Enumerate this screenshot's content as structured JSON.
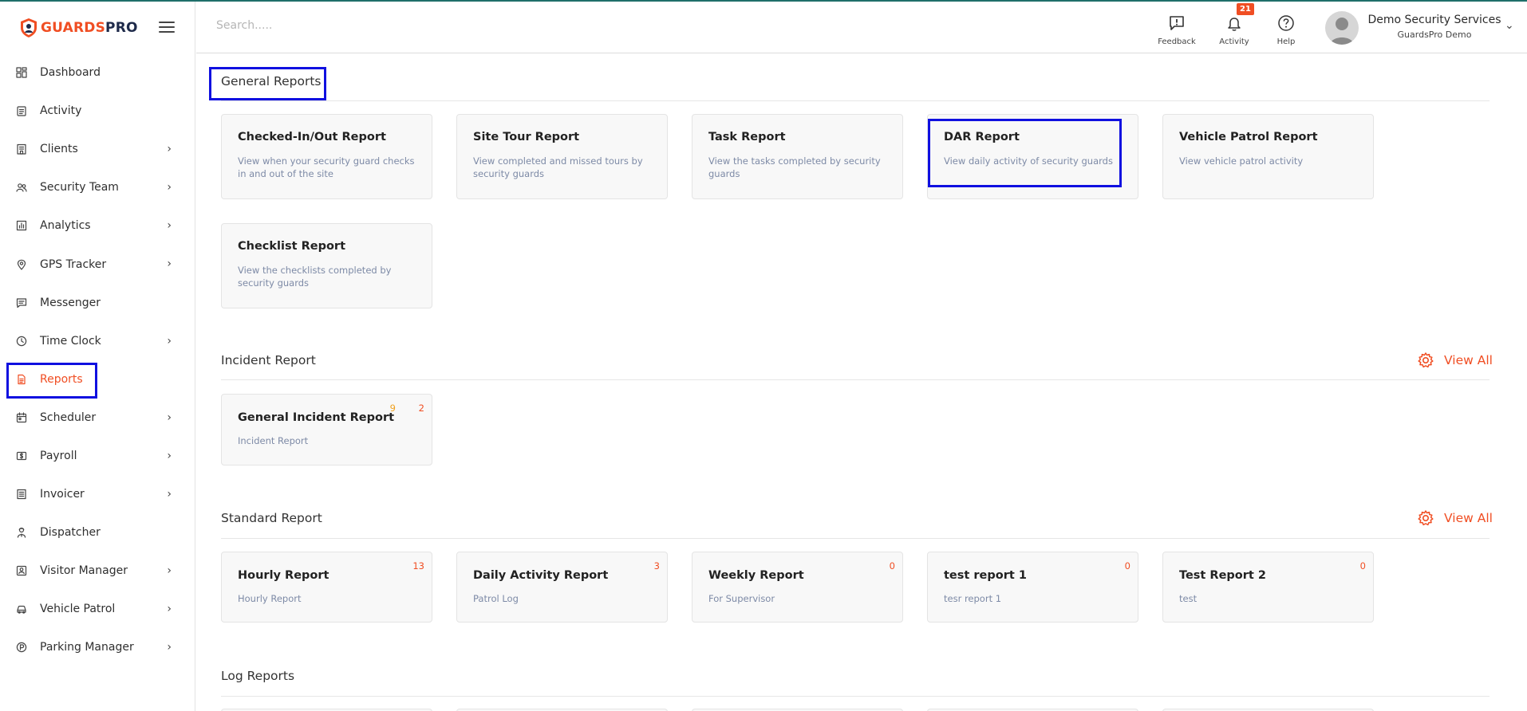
{
  "app": {
    "brand_part1": "GUARDS",
    "brand_part2": "PRO"
  },
  "sidebar": {
    "items": [
      {
        "label": "Dashboard",
        "icon": "dashboard-icon",
        "chevron": false
      },
      {
        "label": "Activity",
        "icon": "clipboard-icon",
        "chevron": false
      },
      {
        "label": "Clients",
        "icon": "building-icon",
        "chevron": true
      },
      {
        "label": "Security Team",
        "icon": "users-icon",
        "chevron": true
      },
      {
        "label": "Analytics",
        "icon": "bar-chart-icon",
        "chevron": true
      },
      {
        "label": "GPS Tracker",
        "icon": "map-pin-icon",
        "chevron": true
      },
      {
        "label": "Messenger",
        "icon": "message-icon",
        "chevron": false
      },
      {
        "label": "Time Clock",
        "icon": "clock-icon",
        "chevron": true
      },
      {
        "label": "Reports",
        "icon": "document-icon",
        "chevron": false,
        "active": true
      },
      {
        "label": "Scheduler",
        "icon": "calendar-icon",
        "chevron": true
      },
      {
        "label": "Payroll",
        "icon": "dollar-icon",
        "chevron": true
      },
      {
        "label": "Invoicer",
        "icon": "invoice-icon",
        "chevron": true
      },
      {
        "label": "Dispatcher",
        "icon": "dispatcher-icon",
        "chevron": false
      },
      {
        "label": "Visitor Manager",
        "icon": "id-card-icon",
        "chevron": true
      },
      {
        "label": "Vehicle Patrol",
        "icon": "car-icon",
        "chevron": true
      },
      {
        "label": "Parking Manager",
        "icon": "parking-icon",
        "chevron": true
      }
    ]
  },
  "header": {
    "search_placeholder": "Search.....",
    "feedback_label": "Feedback",
    "activity_label": "Activity",
    "activity_badge": "21",
    "help_label": "Help",
    "user_name": "Demo Security Services",
    "user_company": "GuardsPro Demo"
  },
  "general_reports": {
    "title": "General Reports",
    "cards": [
      {
        "title": "Checked-In/Out Report",
        "desc": "View when your security guard checks in and out of the site"
      },
      {
        "title": "Site Tour Report",
        "desc": "View completed and missed tours by security guards"
      },
      {
        "title": "Task Report",
        "desc": "View the tasks completed by security guards"
      },
      {
        "title": "DAR Report",
        "desc": "View daily activity of security guards"
      },
      {
        "title": "Vehicle Patrol Report",
        "desc": "View vehicle patrol activity"
      },
      {
        "title": "Checklist Report",
        "desc": "View the checklists completed by security guards"
      }
    ]
  },
  "incident_report": {
    "title": "Incident Report",
    "view_all": "View All",
    "cards": [
      {
        "title": "General Incident Report",
        "desc": "Incident Report",
        "count_orange": "9",
        "count_red": "2"
      }
    ]
  },
  "standard_report": {
    "title": "Standard Report",
    "view_all": "View All",
    "cards": [
      {
        "title": "Hourly Report",
        "desc": "Hourly Report",
        "count": "13"
      },
      {
        "title": "Daily Activity Report",
        "desc": "Patrol Log",
        "count": "3"
      },
      {
        "title": "Weekly Report",
        "desc": "For Supervisor",
        "count": "0"
      },
      {
        "title": "test report 1",
        "desc": "tesr report 1",
        "count": "0"
      },
      {
        "title": "Test Report 2",
        "desc": "test",
        "count": "0"
      }
    ]
  },
  "log_reports": {
    "title": "Log Reports"
  },
  "colors": {
    "accent": "#f04e23",
    "highlight_box": "#1010e0",
    "count_orange": "#f0a11e"
  }
}
